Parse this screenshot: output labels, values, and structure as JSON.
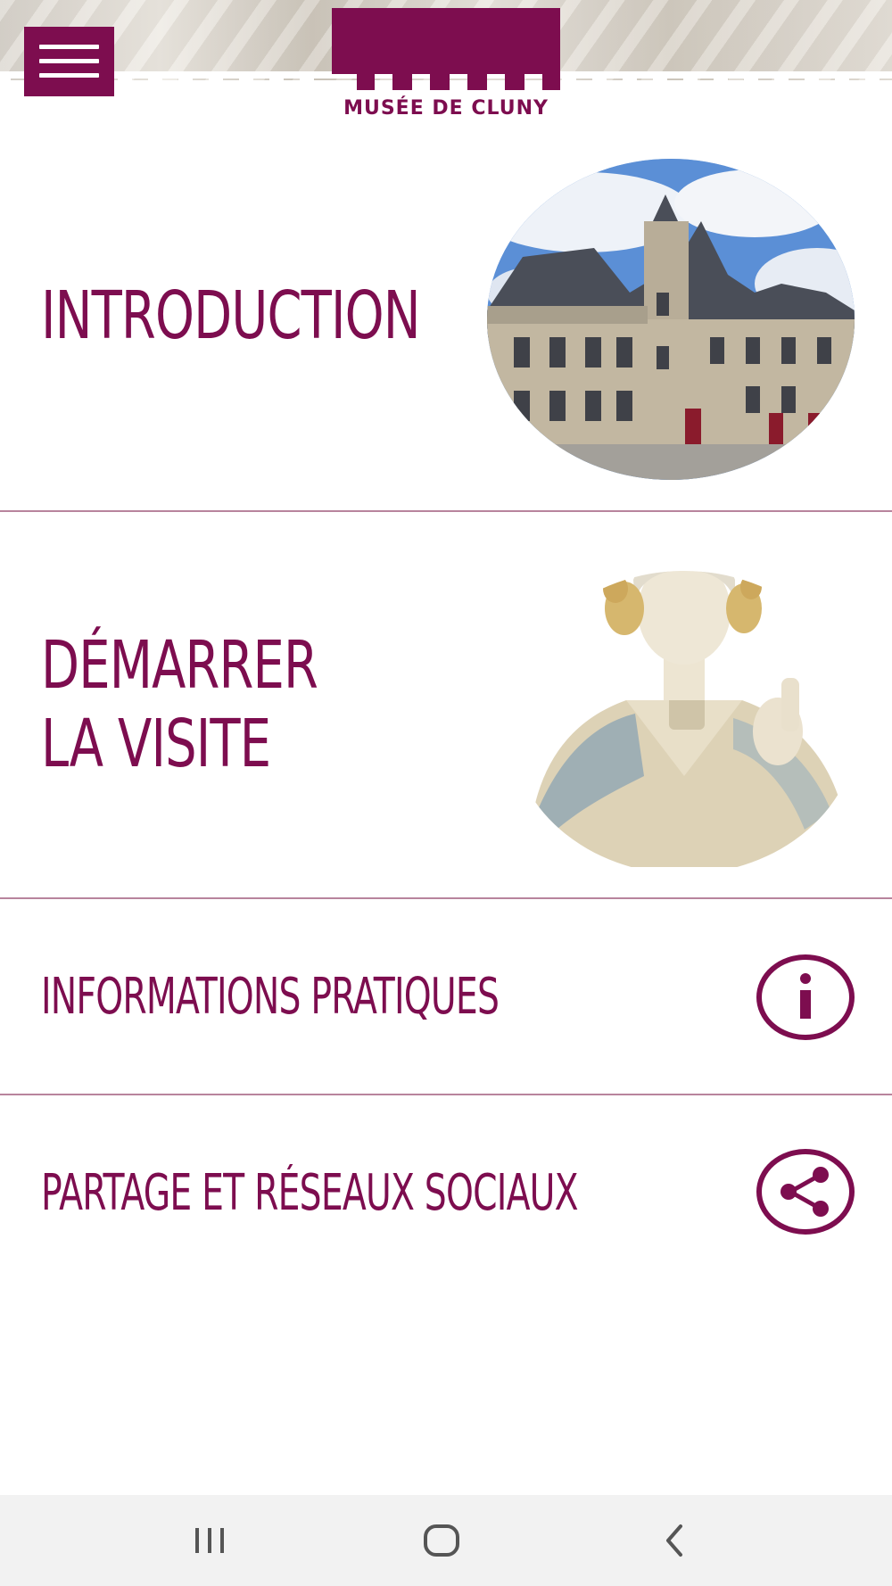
{
  "app": {
    "museum_name": "MUSÉE DE CLUNY",
    "brand_color": "#7d0d4f",
    "divider_color": "#b8849d"
  },
  "header": {
    "menu_icon": "hamburger-menu-icon",
    "logo": "musee-de-cluny-logo"
  },
  "menu": {
    "introduction": {
      "label": "INTRODUCTION",
      "image": "hotel-de-cluny-courtyard-photo"
    },
    "visite": {
      "label_line1": "DÉMARRER",
      "label_line2": "LA VISITE",
      "image": "medieval-sculpture-bust-photo"
    },
    "informations": {
      "label": "INFORMATIONS PRATIQUES",
      "icon": "info-icon"
    },
    "partage": {
      "label": "PARTAGE ET RÉSEAUX SOCIAUX",
      "icon": "share-icon"
    }
  },
  "system_nav": {
    "recent_icon": "recent-apps-icon",
    "home_icon": "home-icon",
    "back_icon": "back-icon"
  }
}
